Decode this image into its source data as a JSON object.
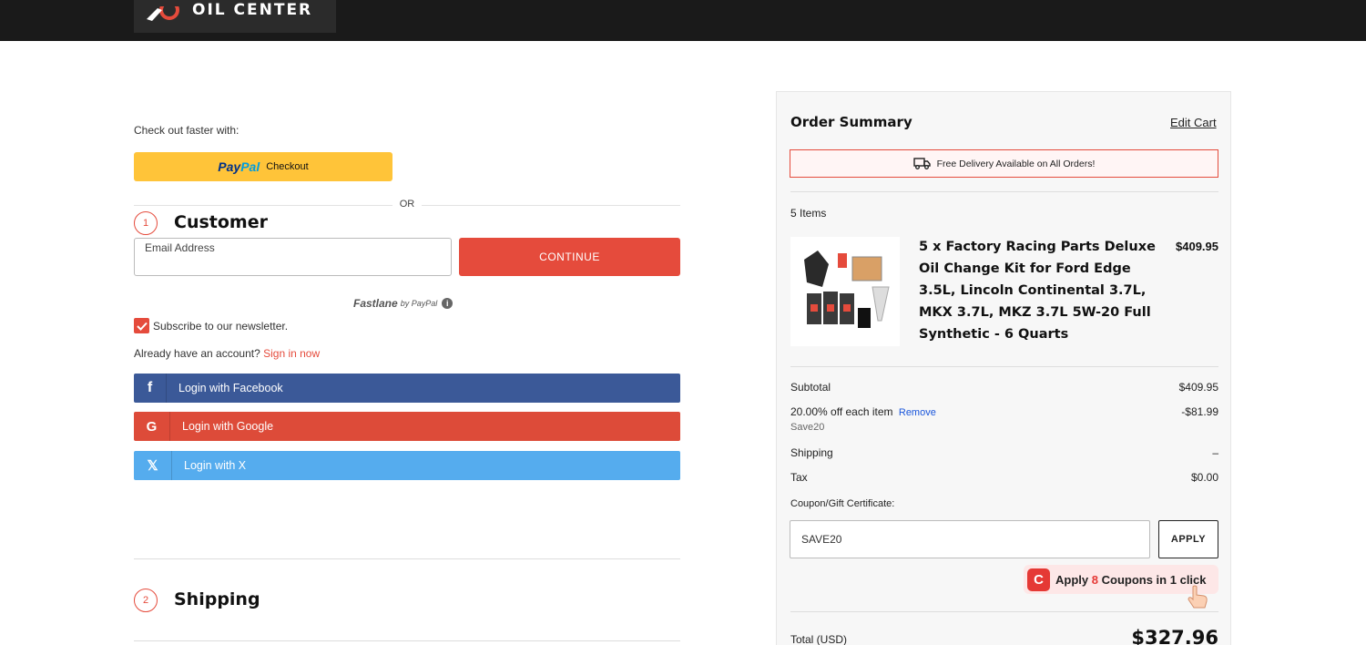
{
  "header": {
    "logo_text": "OIL CENTER"
  },
  "checkout": {
    "faster_label": "Check out faster with:",
    "paypal_pay": "Pay",
    "paypal_pal": "Pal",
    "paypal_checkout": "Checkout",
    "or_label": "OR"
  },
  "customer": {
    "step_number": "1",
    "title": "Customer",
    "email_label": "Email Address",
    "email_value": "",
    "continue_label": "CONTINUE",
    "fastlane_label": "Fastlane",
    "fastlane_by": "by PayPal",
    "info_glyph": "i",
    "newsletter_label": "Subscribe to our newsletter.",
    "newsletter_checked": true,
    "account_prompt": "Already have an account?",
    "sign_in_label": "Sign in now"
  },
  "social_logins": [
    {
      "icon": "facebook-icon",
      "glyph": "f",
      "label": "Login with Facebook",
      "color": "#3b5998"
    },
    {
      "icon": "google-icon",
      "glyph": "G",
      "label": "Login with Google",
      "color": "#dd4b39"
    },
    {
      "icon": "x-icon",
      "glyph": "𝕏",
      "label": "Login with X",
      "color": "#55acee"
    }
  ],
  "shipping": {
    "step_number": "2",
    "title": "Shipping"
  },
  "summary": {
    "title": "Order Summary",
    "edit_cart": "Edit Cart",
    "delivery_note": "Free Delivery Available on All Orders!",
    "items_count": "5 Items",
    "product": {
      "name": "5 x Factory Racing Parts Deluxe Oil Change Kit for Ford Edge 3.5L, Lincoln Continental 3.7L, MKX 3.7L, MKZ 3.7L 5W-20 Full Synthetic - 6 Quarts",
      "price": "$409.95"
    },
    "subtotal_label": "Subtotal",
    "subtotal_value": "$409.95",
    "discount_label": "20.00% off each item",
    "discount_remove": "Remove",
    "discount_code": "Save20",
    "discount_value": "-$81.99",
    "shipping_label": "Shipping",
    "shipping_value": "–",
    "tax_label": "Tax",
    "tax_value": "$0.00",
    "coupon_label": "Coupon/Gift Certificate:",
    "coupon_value": "SAVE20",
    "apply_label": "APPLY",
    "coupon_ext": {
      "prefix": "Apply",
      "count": "8",
      "middle": "Coupons in",
      "clicks": "1",
      "suffix": "click",
      "logo_glyph": "C"
    },
    "total_label": "Total (USD)",
    "total_value": "$327.96"
  },
  "colors": {
    "accent": "#e54b3c",
    "paypal": "#ffc439",
    "header": "#1a1a1a"
  }
}
